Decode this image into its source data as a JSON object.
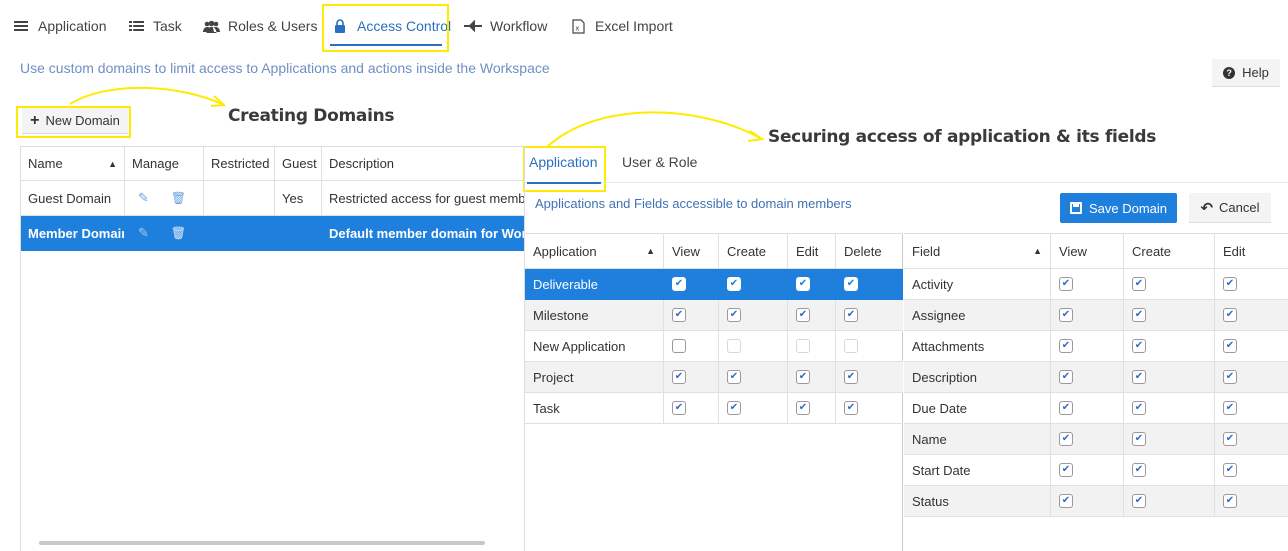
{
  "nav": {
    "items": [
      {
        "label": "Application",
        "icon": "menu-icon"
      },
      {
        "label": "Task",
        "icon": "list-icon"
      },
      {
        "label": "Roles & Users",
        "icon": "users-icon"
      },
      {
        "label": "Access Control",
        "icon": "lock-icon",
        "active": true
      },
      {
        "label": "Workflow",
        "icon": "workflow-icon"
      },
      {
        "label": "Excel Import",
        "icon": "excel-icon"
      }
    ]
  },
  "subtitle": "Use custom domains to limit access to Applications and actions inside the Workspace",
  "help_label": "Help",
  "new_domain_label": "New Domain",
  "annotations": {
    "creating": "Creating Domains",
    "securing": "Securing access of application & its fields"
  },
  "domains": {
    "columns": [
      "Name",
      "Manage",
      "Restricted",
      "Guest",
      "Description"
    ],
    "rows": [
      {
        "name": "Guest Domain",
        "restricted": "",
        "guest": "Yes",
        "description": "Restricted access for guest members",
        "selected": false
      },
      {
        "name": "Member Domain",
        "restricted": "",
        "guest": "",
        "description": "Default member domain for Workspace",
        "selected": true
      }
    ]
  },
  "tabs": [
    {
      "label": "Application",
      "active": true
    },
    {
      "label": "User & Role",
      "active": false
    }
  ],
  "panel_subtitle": "Applications and Fields accessible to domain members",
  "save_label": "Save Domain",
  "cancel_label": "Cancel",
  "applications": {
    "columns": [
      "Application",
      "View",
      "Create",
      "Edit",
      "Delete"
    ],
    "rows": [
      {
        "name": "Deliverable",
        "view": true,
        "create": true,
        "edit": true,
        "delete": true,
        "selected": true
      },
      {
        "name": "Milestone",
        "view": true,
        "create": true,
        "edit": true,
        "delete": true
      },
      {
        "name": "New Application",
        "view": false,
        "create": false,
        "edit": false,
        "delete": false,
        "disabled": true
      },
      {
        "name": "Project",
        "view": true,
        "create": true,
        "edit": true,
        "delete": true
      },
      {
        "name": "Task",
        "view": true,
        "create": true,
        "edit": true,
        "delete": true
      }
    ]
  },
  "fields": {
    "columns": [
      "Field",
      "View",
      "Create",
      "Edit"
    ],
    "rows": [
      {
        "name": "Activity",
        "view": true,
        "create": true,
        "edit": true
      },
      {
        "name": "Assignee",
        "view": true,
        "create": true,
        "edit": true
      },
      {
        "name": "Attachments",
        "view": true,
        "create": true,
        "edit": true
      },
      {
        "name": "Description",
        "view": true,
        "create": true,
        "edit": true
      },
      {
        "name": "Due Date",
        "view": true,
        "create": true,
        "edit": true
      },
      {
        "name": "Name",
        "view": true,
        "create": true,
        "edit": true
      },
      {
        "name": "Start Date",
        "view": true,
        "create": true,
        "edit": true
      },
      {
        "name": "Status",
        "view": true,
        "create": true,
        "edit": true
      }
    ]
  },
  "colors": {
    "accent": "#1f7fdc",
    "highlight": "#ffeb00",
    "link": "#2a6fc1"
  }
}
